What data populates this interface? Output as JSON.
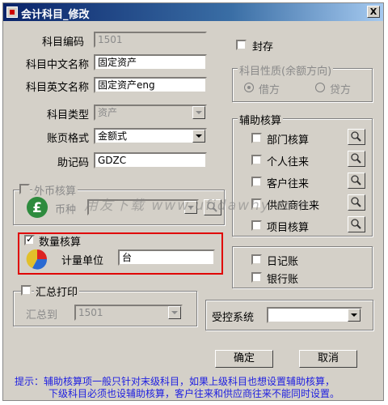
{
  "title": "会计科目_修改",
  "close_label": "X",
  "fields": {
    "code_label": "科目编码",
    "code_value": "1501",
    "cn_label": "科目中文名称",
    "cn_value": "固定资产",
    "en_label": "科目英文名称",
    "en_value": "固定资产eng",
    "type_label": "科目类型",
    "type_value": "资产",
    "format_label": "账页格式",
    "format_value": "金额式",
    "mnemonic_label": "助记码",
    "mnemonic_value": "GDZC"
  },
  "seal_label": "封存",
  "nature": {
    "title": "科目性质(余额方向)",
    "debit": "借方",
    "credit": "贷方"
  },
  "aux": {
    "title": "辅助核算",
    "items": [
      "部门核算",
      "个人往来",
      "客户往来",
      "供应商往来",
      "项目核算"
    ]
  },
  "forex": {
    "title": "外币核算",
    "currency_label": "币种"
  },
  "quantity": {
    "title": "数量核算",
    "unit_label": "计量单位",
    "unit_value": "台"
  },
  "journals": {
    "daily": "日记账",
    "bank": "银行账"
  },
  "summary": {
    "title": "汇总打印",
    "to_label": "汇总到",
    "to_value": "1501"
  },
  "controlled": {
    "label": "受控系统",
    "value": ""
  },
  "buttons": {
    "ok": "确定",
    "cancel": "取消"
  },
  "hint": {
    "line1": "提示：辅助核算项一般只针对末级科目，如果上级科目也想设置辅助核算，",
    "line2": "下级科目必须也设辅助核算，客户往来和供应商往来不能同时设置。"
  },
  "watermark": "用友下载 www.ufidawhy.com",
  "colors": {
    "title_bar": "#0a246a",
    "highlight_box": "#e00000",
    "hint_text": "#2020e0"
  }
}
